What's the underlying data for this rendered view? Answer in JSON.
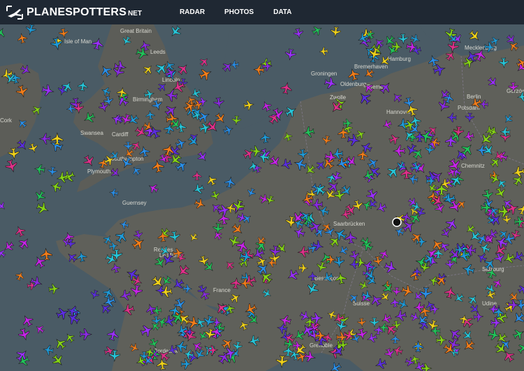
{
  "header": {
    "logo_text": "PLANESPOTTERS",
    "logo_suffix": "NET",
    "nav": [
      {
        "label": "RADAR"
      },
      {
        "label": "PHOTOS"
      },
      {
        "label": "DATA"
      }
    ]
  },
  "map": {
    "labels": [
      {
        "text": "Great Britain"
      },
      {
        "text": "Isle of Man"
      },
      {
        "text": "Leeds"
      },
      {
        "text": "Lincoln"
      },
      {
        "text": "Birmingham"
      },
      {
        "text": "Cardiff"
      },
      {
        "text": "Swansea"
      },
      {
        "text": "Plymouth"
      },
      {
        "text": "Southampton"
      },
      {
        "text": "Cork"
      },
      {
        "text": "Groningen"
      },
      {
        "text": "Oldenburg"
      },
      {
        "text": "Bremerhaven"
      },
      {
        "text": "Bremen"
      },
      {
        "text": "Hamburg"
      },
      {
        "text": "Hannover"
      },
      {
        "text": "Zwolle"
      },
      {
        "text": "Berlin"
      },
      {
        "text": "Potsdam"
      },
      {
        "text": "Chemnitz"
      },
      {
        "text": "Saarbrücken"
      },
      {
        "text": "Guernsey"
      },
      {
        "text": "Rennes"
      },
      {
        "text": "Le Mans"
      },
      {
        "text": "Besançon"
      },
      {
        "text": "Suisse"
      },
      {
        "text": "Bordeaux"
      },
      {
        "text": "Grenoble"
      },
      {
        "text": "Salzburg"
      },
      {
        "text": "Gorzów Wielkopolski"
      },
      {
        "text": "Mecklenburg"
      },
      {
        "text": "France"
      },
      {
        "text": "Udine"
      }
    ],
    "plane_colors": [
      "#c724e8",
      "#9b30ff",
      "#5b2ee0",
      "#2a8fe8",
      "#27c6d9",
      "#22c35a",
      "#86d416",
      "#f0d21b",
      "#f27d1a",
      "#e0308a",
      "#8a2be2",
      "#1f9bd8"
    ]
  }
}
